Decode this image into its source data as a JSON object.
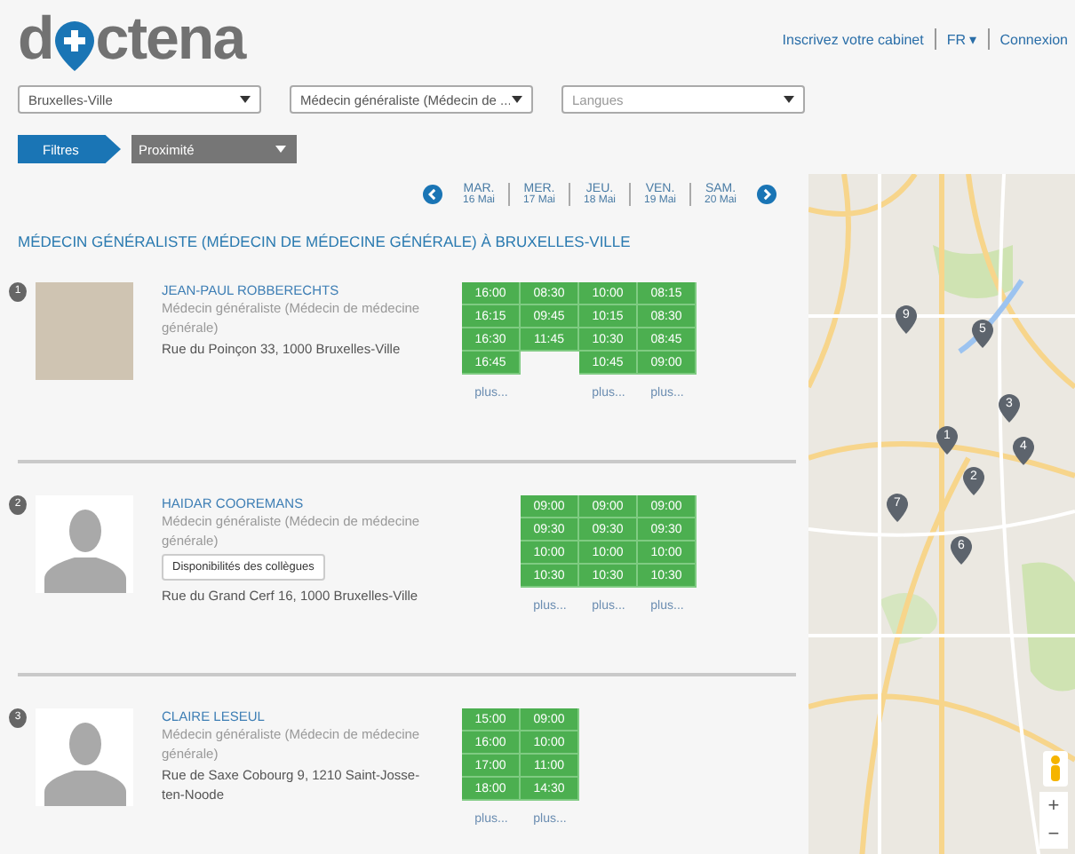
{
  "logo": {
    "before": "d",
    "after": "ctena"
  },
  "nav": {
    "links": [
      {
        "kind": "link",
        "label": "Inscrivez votre cabinet"
      },
      {
        "kind": "menu",
        "label": "FR",
        "caret": "▾"
      },
      {
        "kind": "link",
        "label": "Connexion"
      }
    ]
  },
  "search": {
    "fields": [
      {
        "value": "Bruxelles-Ville"
      },
      {
        "value": "Médecin généraliste (Médecin de ..."
      },
      {
        "placeholder": "Langues"
      }
    ]
  },
  "filters": {
    "button": "Filtres",
    "sort": "Proximité"
  },
  "dates": [
    {
      "day": "MAR.",
      "date": "16 Mai"
    },
    {
      "day": "MER.",
      "date": "17 Mai"
    },
    {
      "day": "JEU.",
      "date": "18 Mai"
    },
    {
      "day": "VEN.",
      "date": "19 Mai"
    },
    {
      "day": "SAM.",
      "date": "20 Mai"
    }
  ],
  "results_title": "MÉDECIN GÉNÉRALISTE (MÉDECIN DE MÉDECINE GÉNÉRALE) À BRUXELLES-VILLE",
  "doctors": [
    {
      "number": "1",
      "has_photo": true,
      "name": "JEAN-PAUL ROBBERECHTS",
      "specialty": "Médecin généraliste (Médecin de médecine générale)",
      "address": "Rue du Poinçon 33, 1000 Bruxelles-Ville",
      "days": [
        {
          "times": [
            "16:00",
            "16:15",
            "16:30",
            "16:45"
          ],
          "more": "plus..."
        },
        {
          "times": [
            "08:30",
            "09:45",
            "11:45"
          ]
        },
        {
          "times": [
            "10:00",
            "10:15",
            "10:30",
            "10:45"
          ],
          "more": "plus..."
        },
        {
          "times": [
            "08:15",
            "08:30",
            "08:45",
            "09:00"
          ],
          "more": "plus..."
        },
        {
          "available": false
        }
      ]
    },
    {
      "number": "2",
      "has_photo": false,
      "name": "HAIDAR COOREMANS",
      "specialty": "Médecin généraliste (Médecin de médecine générale)",
      "colleagues_button": "Disponibilités des collègues",
      "address": "Rue du Grand Cerf 16, 1000 Bruxelles-Ville",
      "days": [
        {
          "available": false
        },
        {
          "times": [
            "09:00",
            "09:30",
            "10:00",
            "10:30"
          ],
          "more": "plus..."
        },
        {
          "times": [
            "09:00",
            "09:30",
            "10:00",
            "10:30"
          ],
          "more": "plus..."
        },
        {
          "times": [
            "09:00",
            "09:30",
            "10:00",
            "10:30"
          ],
          "more": "plus..."
        },
        {
          "available": false
        }
      ]
    },
    {
      "number": "3",
      "has_photo": false,
      "name": "CLAIRE LESEUL",
      "specialty": "Médecin généraliste (Médecin de médecine générale)",
      "address": "Rue de Saxe Cobourg 9, 1210 Saint-Josse-ten-Noode",
      "days": [
        {
          "times": [
            "15:00",
            "16:00",
            "17:00",
            "18:00"
          ],
          "more": "plus..."
        },
        {
          "times": [
            "09:00",
            "10:00",
            "11:00",
            "14:30"
          ],
          "more": "plus..."
        },
        {
          "available": false
        },
        {
          "available": false
        },
        {
          "available": false
        }
      ]
    }
  ],
  "map": {
    "pins": [
      "9",
      "5",
      "3",
      "4",
      "1",
      "2",
      "7",
      "6"
    ],
    "zoom_controls": [
      "+",
      "−"
    ]
  }
}
